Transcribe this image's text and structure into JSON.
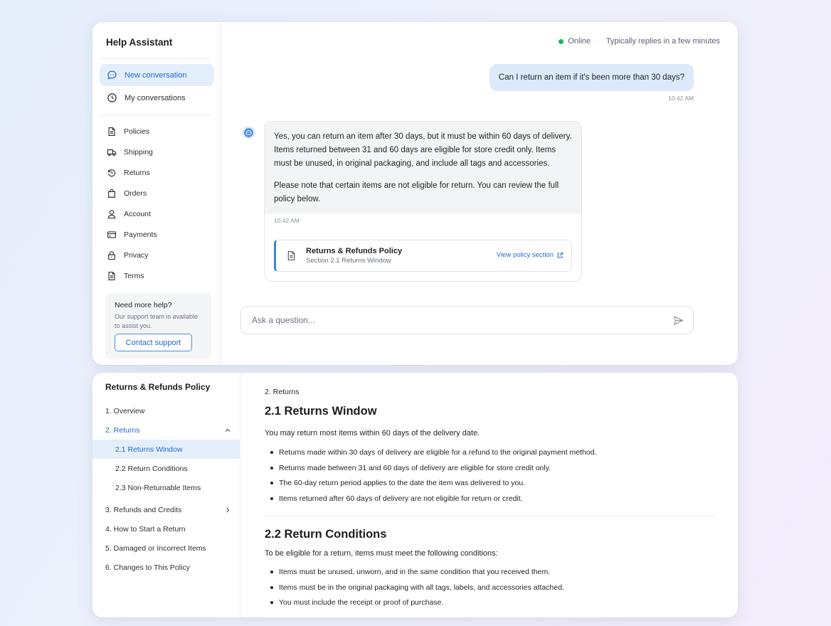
{
  "sidebar": {
    "title": "Help Assistant",
    "primary": [
      {
        "label": "New conversation",
        "icon": "chat-bubble-icon"
      },
      {
        "label": "My conversations",
        "icon": "clock-icon"
      }
    ],
    "categories": [
      {
        "label": "Policies",
        "icon": "document-icon"
      },
      {
        "label": "Shipping",
        "icon": "truck-icon"
      },
      {
        "label": "Returns",
        "icon": "return-arrow-icon"
      },
      {
        "label": "Orders",
        "icon": "shopping-bag-icon"
      },
      {
        "label": "Account",
        "icon": "user-icon"
      },
      {
        "label": "Payments",
        "icon": "credit-card-icon"
      },
      {
        "label": "Privacy",
        "icon": "lock-icon"
      },
      {
        "label": "Terms",
        "icon": "document-icon"
      }
    ],
    "help": {
      "title": "Need more help?",
      "text": "Our support team is available to assist you.",
      "button": "Contact support"
    }
  },
  "chat": {
    "status": {
      "label": "Online",
      "detail": "Typically replies in a few minutes",
      "color": "#22b45a"
    },
    "user_message": {
      "text": "Can I return an item if it's been more than 30 days?",
      "time": "10:42 AM"
    },
    "bot_message": {
      "paragraphs": [
        "Yes, you can return an item after 30 days, but it must be within 60 days of delivery. Items returned between 31 and 60 days are eligible for store credit only. Items must be unused, in original packaging, and include all tags and accessories.",
        "Please note that certain items are not eligible for return. You can review the full policy below."
      ],
      "time": "10:42 AM",
      "reference": {
        "title": "Returns & Refunds Policy",
        "subtitle": "Section 2.1 Returns Window",
        "link": "View policy section"
      }
    },
    "input": {
      "placeholder": "Ask a question..."
    }
  },
  "policy_doc": {
    "toc_title": "Returns & Refunds Policy",
    "toc": [
      {
        "label": "1. Overview"
      },
      {
        "label": "2. Returns",
        "expanded": true
      },
      {
        "label": "2.1 Returns Window",
        "selected": true
      },
      {
        "label": "2.2 Return Conditions"
      },
      {
        "label": "2.3 Non-Returnable Items"
      },
      {
        "label": "3. Refunds and Credits",
        "collapsed": true
      },
      {
        "label": "4. How to Start a Return"
      },
      {
        "label": "5. Damaged or Incorrect Items"
      },
      {
        "label": "6. Changes to This Policy"
      }
    ],
    "breadcrumb": "2. Returns",
    "sections": [
      {
        "heading": "2.1 Returns Window",
        "intro": "You may return most items within 60 days of the delivery date.",
        "bullets": [
          "Returns made within 30 days of delivery are eligible for a refund to the original payment method.",
          "Returns made between 31 and 60 days of delivery are eligible for store credit only.",
          "The 60-day return period applies to the date the item was delivered to you.",
          "Items returned after 60 days of delivery are not eligible for return or credit."
        ]
      },
      {
        "heading": "2.2 Return Conditions",
        "intro": "To be eligible for a return, items must meet the following conditions:",
        "bullets": [
          "Items must be unused, unworn, and in the same condition that you received them.",
          "Items must be in the original packaging with all tags, labels, and accessories attached.",
          "You must include the receipt or proof of purchase."
        ]
      }
    ]
  },
  "colors": {
    "accent": "#1e6ad0",
    "accent_bg": "#e4effc",
    "user_bubble": "#dceafb",
    "bot_bubble": "#f3f4f6"
  }
}
